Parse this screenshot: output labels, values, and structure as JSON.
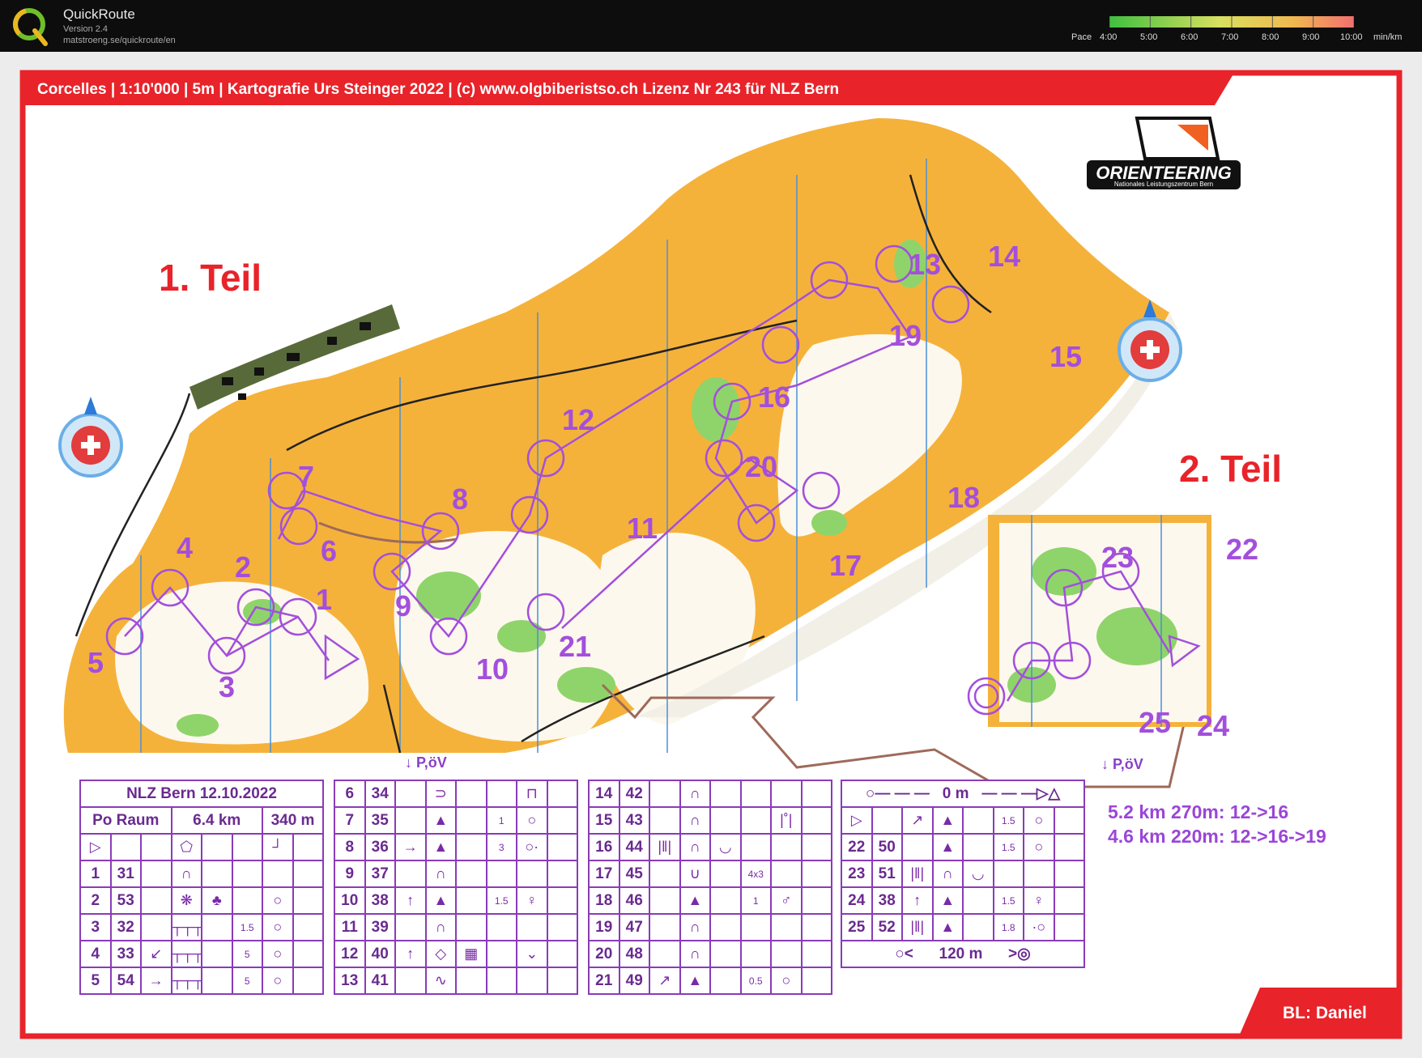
{
  "app": {
    "name": "QuickRoute",
    "version": "Version 2.4",
    "url": "matstroeng.se/quickroute/en",
    "pace_label": "Pace",
    "pace_ticks": [
      "4:00",
      "5:00",
      "6:00",
      "7:00",
      "8:00",
      "9:00",
      "10:00"
    ],
    "pace_unit": "min/km"
  },
  "map": {
    "header": "Corcelles | 1:10'000 | 5m | Kartografie Urs Steinger 2022 | (c) www.olgbiberistso.ch Lizenz Nr 243 für NLZ Bern",
    "logo_text": "ORIENTEERING",
    "logo_subtext": "Nationales Leistungszentrum Bern",
    "part1": "1. Teil",
    "part2": "2. Teil",
    "parking_label": "P,öV",
    "stats_line1": "5.2 km 270m: 12->16",
    "stats_line2": "4.6 km 220m: 12->16->19",
    "footer_badge": "BL: Daniel",
    "control_numbers": [
      "1",
      "2",
      "3",
      "4",
      "5",
      "6",
      "7",
      "8",
      "9",
      "10",
      "11",
      "12",
      "13",
      "14",
      "15",
      "16",
      "17",
      "18",
      "19",
      "20",
      "21",
      "22",
      "23",
      "24",
      "25"
    ]
  },
  "descriptions": {
    "event": "NLZ Bern 12.10.2022",
    "category": "Po Raum",
    "length": "6.4 km",
    "climb": "340 m",
    "table1": [
      [
        "1",
        "31"
      ],
      [
        "2",
        "53"
      ],
      [
        "3",
        "32"
      ],
      [
        "4",
        "33"
      ],
      [
        "5",
        "54"
      ]
    ],
    "table2": [
      [
        "6",
        "34"
      ],
      [
        "7",
        "35"
      ],
      [
        "8",
        "36"
      ],
      [
        "9",
        "37"
      ],
      [
        "10",
        "38"
      ],
      [
        "11",
        "39"
      ],
      [
        "12",
        "40"
      ],
      [
        "13",
        "41"
      ]
    ],
    "table3": [
      [
        "14",
        "42"
      ],
      [
        "15",
        "43"
      ],
      [
        "16",
        "44"
      ],
      [
        "17",
        "45"
      ],
      [
        "18",
        "46"
      ],
      [
        "19",
        "47"
      ],
      [
        "20",
        "48"
      ],
      [
        "21",
        "49"
      ]
    ],
    "table4": [
      [
        "22",
        "50"
      ],
      [
        "23",
        "51"
      ],
      [
        "24",
        "38"
      ],
      [
        "25",
        "52"
      ]
    ],
    "marked_route_top": "0 m",
    "marked_route_bottom": "120 m",
    "small_values": [
      "1",
      "3",
      "1.5",
      "5",
      "5",
      "4x3",
      "1",
      "0.5",
      "1.5",
      "1.5",
      "1.5",
      "1.5",
      "1.8"
    ]
  },
  "colors": {
    "frame_red": "#e8232a",
    "course_purple": "#a34fdc",
    "open_land": "#f5b23a",
    "forest_green": "#8fd46a",
    "route_brown": "#9e6a5a"
  }
}
